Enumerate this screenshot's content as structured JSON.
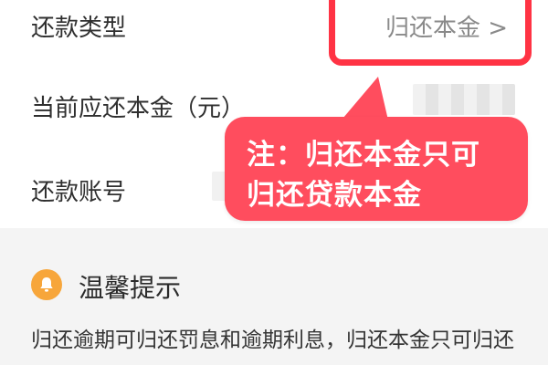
{
  "form": {
    "repayment_type_label": "还款类型",
    "repayment_type_value": "归还本金 >",
    "current_principal_label": "当前应还本金（元）",
    "repayment_account_label": "还款账号"
  },
  "callout": {
    "line1": "注：归还本金只可",
    "line2": "归还贷款本金"
  },
  "tips": {
    "title": "温馨提示",
    "text": "归还逾期可归还罚息和逾期利息，归还本金只可归还"
  },
  "colors": {
    "highlight": "#ff3344",
    "callout_background": "#ff4d5e",
    "tips_icon": "#f7a63b"
  },
  "icons": {
    "tips": "bell-icon"
  }
}
